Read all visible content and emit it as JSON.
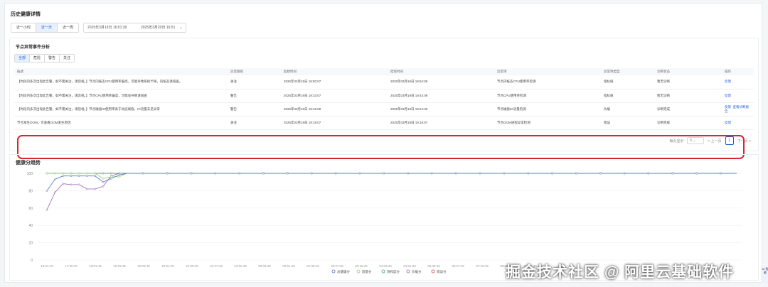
{
  "header": {
    "title": "历史健康详情"
  },
  "time_tabs": [
    "近一小时",
    "近一天",
    "近一周"
  ],
  "active_time_tab": 1,
  "date_range": {
    "start": "2025年3月19日 16:51:39",
    "end": "2025年3月20日 16:51"
  },
  "events": {
    "title": "节点异常事件分析",
    "filters": [
      "全部",
      "危险",
      "警告",
      "关注"
    ],
    "active_filter": 0,
    "columns": [
      "描述",
      "异常级别",
      "起始时间",
      "结束时间",
      "异常项",
      "异常项类型",
      "诊断状态",
      "操作"
    ],
    "rows": [
      {
        "desc": "【时段内多次出现此告警，如不需关注，请忽视。】节点内核态CPU使用率偏高，可能导致系统卡顿，内核态请排查。",
        "level": "关注",
        "start": "2025年03月19日 19:50:07",
        "end": "2025年03月19日 19:54:09",
        "item": "节点内核态CPU使用率检测",
        "type": "指标值",
        "status": "暂无诊断",
        "ops": [
          "反馈"
        ]
      },
      {
        "desc": "【时段内多次出现此告警，如不需关注，请忽视。】节点CPU使用率偏高，可能会导致请排查",
        "level": "警告",
        "start": "2025年03月19日 19:33:07",
        "end": "2025年03月19日 19:44:09",
        "item": "节点CPU使用率检测",
        "type": "指标值",
        "status": "暂无诊断",
        "ops": [
          "反馈"
        ]
      },
      {
        "desc": "【时段内多次出现此告警，如不需关注，请忽视。】节点磁盘IO使用率高于动态阈值，IO流量未见异常",
        "level": "警告",
        "start": "2025年03月19日 19:15:08",
        "end": "2025年03月19日 19:24:36",
        "item": "节点磁盘IO流量检测",
        "type": "负载",
        "status": "诊断完成",
        "ops": [
          "反馈",
          "查看诊断报告"
        ]
      },
      {
        "desc": "节点发生OOM，可查看OOM发生原因",
        "level": "关注",
        "start": "2025年03月19日 19:18:07",
        "end": "2025年03月19日 19:18:07",
        "item": "节点OOM进程异常检测",
        "type": "错误",
        "status": "诊断完成",
        "ops": [
          "反馈"
        ]
      }
    ],
    "pagination": {
      "label": "每页显示",
      "page_size": "5",
      "prev": "< 上一页",
      "page": "1",
      "next": "下一页 >"
    }
  },
  "trend": {
    "title": "健康分趋势"
  },
  "watermark": "掘金技术社区 @ 阿里云基础软件",
  "ai_badge": "AI 智能",
  "chart_data": {
    "type": "line",
    "ylim": [
      0,
      100
    ],
    "yticks": [
      0,
      20,
      40,
      60,
      80,
      100
    ],
    "categories": [
      "16:01:49",
      "17:36:49",
      "18:01:49",
      "19:15:49",
      "20:03:49",
      "20:51:49",
      "21:39:49",
      "22:27:49",
      "23:15:49",
      "00:03:49",
      "00:51:49",
      "01:39:49",
      "02:27:49",
      "03:15:49",
      "04:03:49",
      "04:51:49",
      "05:39:49",
      "06:27:49",
      "07:15:49",
      "08:03:49",
      "08:51:49",
      "09:39:49",
      "10:27:49",
      "11:15:49",
      "12:03:49",
      "12:51:49",
      "13:39:49",
      "14:27:49",
      "15:15:49"
    ],
    "x_labels": [
      "16:01:49",
      "17:36:49",
      "18:01:49",
      "19:15:49",
      "20:03:49",
      "20:51:49",
      "21:39:49",
      "22:27:49",
      "23:15:49",
      "00:03:49",
      "00:51:49",
      "01:39:49",
      "02:27:49",
      "03:15:49",
      "04:03:49",
      "04:51:49",
      "05:39:49",
      "06:27:49",
      "07:15:49",
      "08:03:49",
      "08:51:49"
    ],
    "legend_position": "bottom",
    "grid": true,
    "series": [
      {
        "name": "总健康分",
        "color": "#5470c6",
        "values": [
          80,
          93,
          97,
          97,
          97,
          97,
          97,
          90,
          94,
          98,
          100,
          100,
          100,
          100,
          100,
          100,
          100,
          100,
          100,
          100,
          100,
          100,
          100,
          100,
          100,
          100,
          100,
          100,
          100,
          100,
          100,
          100,
          100,
          100,
          100,
          100,
          100,
          100,
          100,
          100,
          100,
          100,
          100,
          100,
          100,
          100,
          100,
          100,
          100,
          100,
          100,
          100,
          100,
          100,
          100,
          100,
          100,
          100,
          100,
          100,
          100,
          100,
          100,
          100,
          100,
          100,
          100,
          100,
          100,
          100,
          100,
          100,
          100,
          100,
          100,
          100,
          100,
          100,
          100,
          100,
          100,
          100,
          100,
          100,
          100,
          100,
          100
        ]
      },
      {
        "name": "容量分",
        "color": "#91cc75",
        "values": [
          100,
          100,
          100,
          100,
          100,
          100,
          100,
          94,
          96,
          96,
          100,
          100,
          100,
          100,
          100,
          100,
          100,
          100,
          100,
          100,
          100,
          100,
          100,
          100,
          100,
          100,
          100,
          100,
          100,
          100,
          100,
          100,
          100,
          100,
          100,
          100,
          100,
          100,
          100,
          100,
          100,
          100,
          100,
          100,
          100,
          100,
          100,
          100,
          100,
          100,
          100,
          100,
          100,
          100,
          100,
          100,
          100,
          100,
          100,
          100,
          100,
          100,
          100,
          100,
          100,
          100,
          100,
          100,
          100,
          100,
          100,
          100,
          100,
          100,
          100,
          100,
          100,
          100,
          100,
          100,
          100,
          100,
          100,
          100,
          100,
          100,
          100
        ]
      },
      {
        "name": "饱和度分",
        "color": "#3ba272",
        "values": [
          100,
          100,
          100,
          100,
          100,
          100,
          100,
          100,
          100,
          100,
          100,
          100,
          100,
          100,
          100,
          100,
          100,
          100,
          100,
          100,
          100,
          100,
          100,
          100,
          100,
          100,
          100,
          100,
          100,
          100,
          100,
          100,
          100,
          100,
          100,
          100,
          100,
          100,
          100,
          100,
          100,
          100,
          100,
          100,
          100,
          100,
          100,
          100,
          100,
          100,
          100,
          100,
          100,
          100,
          100,
          100,
          100,
          100,
          100,
          100,
          100,
          100,
          100,
          100,
          100,
          100,
          100,
          100,
          100,
          100,
          100,
          100,
          100,
          100,
          100,
          100,
          100,
          100,
          100,
          100,
          100,
          100,
          100,
          100,
          100,
          100,
          100
        ]
      },
      {
        "name": "负载分",
        "color": "#9a60b4",
        "values": [
          58,
          78,
          88,
          87,
          87,
          82,
          82,
          85,
          97,
          100,
          100,
          100,
          100,
          100,
          100,
          100,
          100,
          100,
          100,
          100,
          100,
          100,
          100,
          100,
          100,
          100,
          100,
          100,
          100,
          100,
          100,
          100,
          100,
          100,
          100,
          100,
          100,
          100,
          100,
          100,
          100,
          100,
          100,
          100,
          100,
          100,
          100,
          100,
          100,
          100,
          100,
          100,
          100,
          100,
          100,
          100,
          100,
          100,
          100,
          100,
          100,
          100,
          100,
          100,
          100,
          100,
          100,
          100,
          100,
          100,
          100,
          100,
          100,
          100,
          100,
          100,
          100,
          100,
          100,
          100,
          100,
          100,
          100,
          100,
          100,
          100,
          100
        ]
      },
      {
        "name": "错误分",
        "color": "#d9434f",
        "values": [
          100,
          100,
          100,
          100,
          100,
          100,
          100,
          100,
          100,
          100,
          100,
          100,
          100,
          100,
          100,
          100,
          100,
          100,
          100,
          100,
          100,
          100,
          100,
          100,
          100,
          100,
          100,
          100,
          100,
          100,
          100,
          100,
          100,
          100,
          100,
          100,
          100,
          100,
          100,
          100,
          100,
          100,
          100,
          100,
          100,
          100,
          100,
          100,
          100,
          100,
          100,
          100,
          100,
          100,
          100,
          100,
          100,
          100,
          100,
          100,
          100,
          100,
          100,
          100,
          100,
          100,
          100,
          100,
          100,
          100,
          100,
          100,
          100,
          100,
          100,
          100,
          100,
          100,
          100,
          100,
          100,
          100,
          100,
          100,
          100,
          100,
          100
        ]
      }
    ]
  }
}
